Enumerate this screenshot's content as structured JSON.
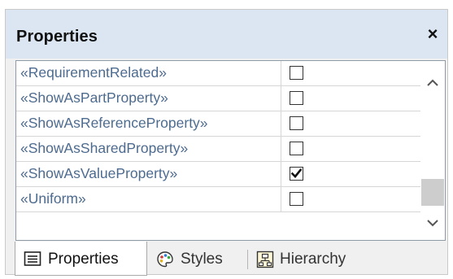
{
  "panel": {
    "title": "Properties",
    "close_glyph": "×"
  },
  "rows": [
    {
      "name": "«RequirementRelated»",
      "checked": false
    },
    {
      "name": "«ShowAsPartProperty»",
      "checked": false
    },
    {
      "name": "«ShowAsReferenceProperty»",
      "checked": false
    },
    {
      "name": "«ShowAsSharedProperty»",
      "checked": false
    },
    {
      "name": "«ShowAsValueProperty»",
      "checked": true
    },
    {
      "name": "«Uniform»",
      "checked": false
    }
  ],
  "tabs": [
    {
      "label": "Properties",
      "icon": "properties-list-icon",
      "active": true
    },
    {
      "label": "Styles",
      "icon": "palette-icon",
      "active": false
    },
    {
      "label": "Hierarchy",
      "icon": "hierarchy-icon",
      "active": false
    }
  ],
  "colors": {
    "title_bar": "#dbe6f2",
    "row_text": "#4d6b8f"
  }
}
